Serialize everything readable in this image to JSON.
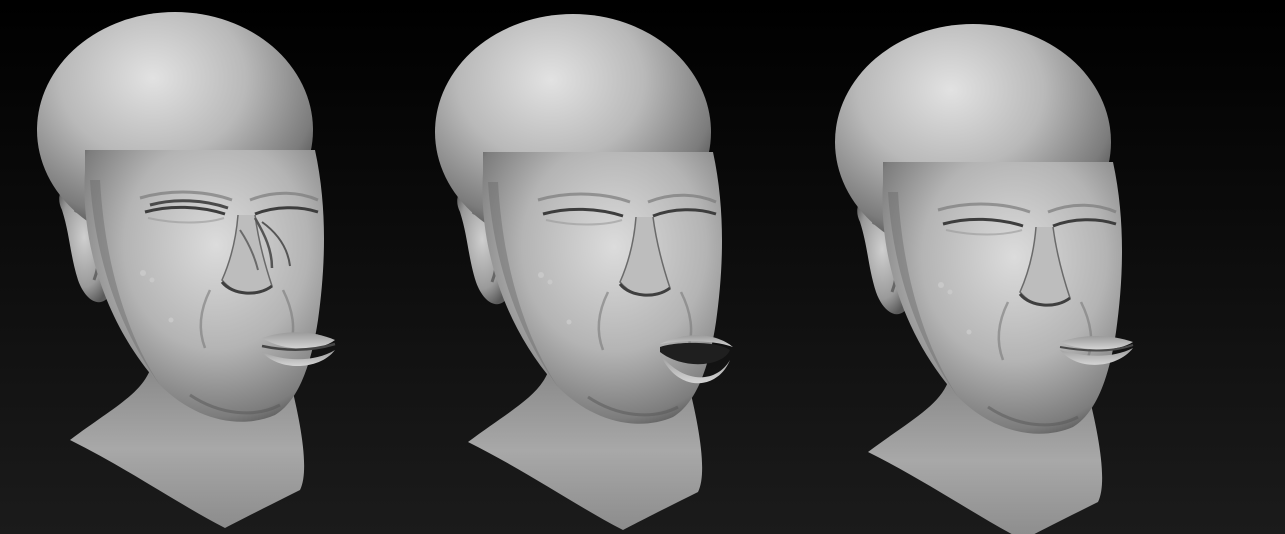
{
  "scene": {
    "description_free": true,
    "background_color_top": "#000000",
    "background_color_bottom": "#1b1b1b",
    "clay_color_light": "#d8d8d8",
    "clay_color_mid": "#9a9a9a",
    "clay_color_dark": "#3a3a3a",
    "heads": [
      {
        "expression": "squint",
        "mouth_open": 0
      },
      {
        "expression": "open-mouth",
        "mouth_open": 1
      },
      {
        "expression": "eyes-closed-neutral",
        "mouth_open": 0
      }
    ]
  }
}
